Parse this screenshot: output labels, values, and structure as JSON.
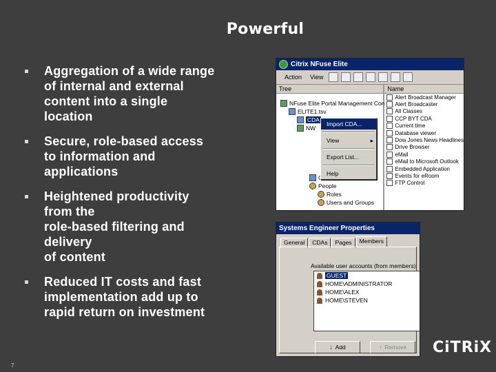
{
  "slide": {
    "title": "Powerful",
    "page_number": "7",
    "bullets": [
      {
        "text": "Aggregation of a wide range\nof internal and external\ncontent into a single\nlocation"
      },
      {
        "text": "Secure, role-based access\nto information and\napplications"
      },
      {
        "text": "Heightened productivity\nfrom the\nrole-based filtering and\ndelivery\nof content"
      },
      {
        "text": "Reduced IT costs and fast\nimplementation add up to\nrapid return on investment"
      }
    ],
    "logo_text": "CiTRiX"
  },
  "console": {
    "title": "Citrix NFuse Elite",
    "menu": {
      "action": "Action",
      "view": "View"
    },
    "tree_header": "Tree",
    "list_header": "Name",
    "tree": {
      "root": "NFuse Elite Portal Management Console",
      "node_a": "ELITE1.tsv",
      "node_b": "CDA",
      "node_c": "NW",
      "other_content": "Other Content",
      "people": "People",
      "roles": "Roles",
      "users_groups": "Users and Groups"
    },
    "context_menu": {
      "import": "Import CDA...",
      "view": "View",
      "export": "Export List...",
      "help": "Help"
    },
    "list_items": [
      "Alert Broadcast Manager",
      "Alert Broadcaster",
      "All Classes",
      "CCP BYT CDA",
      "Current time",
      "Database viewer",
      "Dow Jones News Headlines",
      "Drive Browser",
      "eMail",
      "eMail to Microsoft Outlook",
      "Embedded Application",
      "Events for eRoom",
      "FTP Control"
    ]
  },
  "properties": {
    "title": "Systems Engineer Properties",
    "tabs": [
      "General",
      "CDAs",
      "Pages",
      "Members"
    ],
    "available_label": "Available user accounts (from members):",
    "accounts": [
      "GUEST",
      "HOME\\ADMINISTRATOR",
      "HOME\\ALEX",
      "HOME\\STEVEN"
    ],
    "add_label": "Add",
    "remove_label": "Remove"
  }
}
